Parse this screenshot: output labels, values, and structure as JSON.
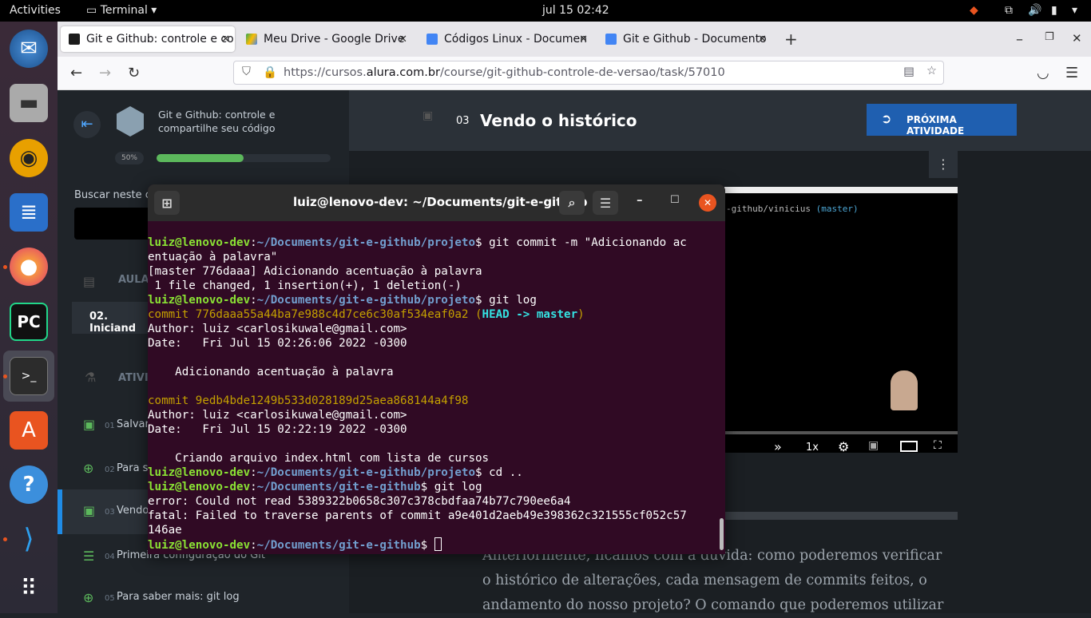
{
  "topbar": {
    "activities": "Activities",
    "app": "Terminal",
    "clock": "jul 15  02:42"
  },
  "dock": {
    "items": [
      "thunderbird-icon",
      "files-icon",
      "rhythmbox-icon",
      "writer-icon",
      "firefox-icon",
      "pycharm-icon",
      "terminal-icon",
      "software-icon",
      "help-icon",
      "vscode-icon",
      "apps-grid-icon"
    ]
  },
  "browser": {
    "tabs": [
      {
        "label": "Git e Github: controle e co",
        "color": "#1c1c1c"
      },
      {
        "label": "Meu Drive - Google Drive",
        "color": "#34a853"
      },
      {
        "label": "Códigos Linux - Documen",
        "color": "#4285f4"
      },
      {
        "label": "Git e Github - Documento",
        "color": "#4285f4"
      }
    ],
    "new_tab": "+",
    "url_prefix": "https://cursos.",
    "url_domain": "alura.com.br",
    "url_path": "/course/git-github-controle-de-versao/task/57010"
  },
  "course": {
    "title_line1": "Git e Github: controle e",
    "title_line2": "compartilhe seu código",
    "progress_label": "50%",
    "progress": 0.5,
    "search_label": "Buscar neste c",
    "section_label": "AULA",
    "lesson": "02. Iniciand",
    "activities_label": "ATIVI",
    "items": [
      {
        "num": "01",
        "label": "Salvan"
      },
      {
        "num": "02",
        "label": "Para s"
      },
      {
        "num": "03",
        "label": "Vendo"
      },
      {
        "num": "04",
        "label": "Primeira configuração do Git"
      },
      {
        "num": "05",
        "label": "Para saber mais: git log"
      }
    ]
  },
  "page": {
    "num": "03",
    "title": "Vendo o histórico",
    "next_button": "PRÓXIMA ATIVIDADE",
    "video_path": "-github/vinicius",
    "video_branch": "(master)",
    "speed": "1x",
    "text1": "Anteriormente, ficamos com a dúvida: como poderemos verificar",
    "text2": "o histórico de alterações, cada mensagem de commits feitos, o",
    "text3": "andamento do nosso projeto? O comando que poderemos utilizar"
  },
  "terminal": {
    "title": "luiz@lenovo-dev: ~/Documents/git-e-github",
    "user": "luiz@lenovo-dev",
    "path1": "~/Documents/git-e-github/projeto",
    "path2": "~/Documents/git-e-github",
    "l1cmd": "$ git commit -m \"Adicionando ac",
    "l2": "entuação à palavra\"",
    "l3": "[master 776daaa] Adicionando acentuação à palavra",
    "l4": " 1 file changed, 1 insertion(+), 1 deletion(-)",
    "l5cmd": "$ git log",
    "l6a": "commit 776daaa55a44ba7e988c4d7ce6c30af534eaf0a2 (",
    "l6b": "HEAD -> master",
    "l6c": ")",
    "l7": "Author: luiz <carlosikuwale@gmail.com>",
    "l8": "Date:   Fri Jul 15 02:26:06 2022 -0300",
    "l10": "    Adicionando acentuação à palavra",
    "l12": "commit 9edb4bde1249b533d028189d25aea868144a4f98",
    "l13": "Author: luiz <carlosikuwale@gmail.com>",
    "l14": "Date:   Fri Jul 15 02:22:19 2022 -0300",
    "l16": "    Criando arquivo index.html com lista de cursos",
    "l17cmd": "$ cd ..",
    "l18cmd": "$ git log",
    "l19": "error: Could not read 5389322b0658c307c378cbdfaa74b77c790ee6a4",
    "l20": "fatal: Failed to traverse parents of commit a9e401d2aeb49e398362c321555cf052c57",
    "l21": "146ae",
    "l22cmd": "$ "
  }
}
